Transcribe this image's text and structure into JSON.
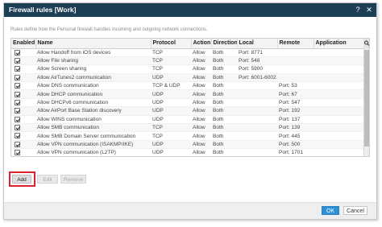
{
  "window": {
    "title": "Firewall rules [Work]"
  },
  "description": "Rules define how the Personal firewall handles incoming and outgoing network connections.",
  "table": {
    "columns": [
      "Enabled",
      "Name",
      "Protocol",
      "Action",
      "Direction",
      "Local",
      "Remote",
      "Application"
    ],
    "rows": [
      {
        "enabled": true,
        "name": "Allow Handoff from iOS devices",
        "protocol": "TCP",
        "action": "Allow",
        "direction": "Both",
        "local": "Port: 8771",
        "remote": "",
        "application": ""
      },
      {
        "enabled": true,
        "name": "Allow File sharing",
        "protocol": "TCP",
        "action": "Allow",
        "direction": "Both",
        "local": "Port: 548",
        "remote": "",
        "application": ""
      },
      {
        "enabled": true,
        "name": "Allow Screen sharing",
        "protocol": "TCP",
        "action": "Allow",
        "direction": "Both",
        "local": "Port: 5900",
        "remote": "",
        "application": ""
      },
      {
        "enabled": true,
        "name": "Allow AirTunes2 communication",
        "protocol": "UDP",
        "action": "Allow",
        "direction": "Both",
        "local": "Port: 6001-6002",
        "remote": "",
        "application": ""
      },
      {
        "enabled": true,
        "name": "Allow DNS communication",
        "protocol": "TCP & UDP",
        "action": "Allow",
        "direction": "Both",
        "local": "",
        "remote": "Port: 53",
        "application": ""
      },
      {
        "enabled": true,
        "name": "Allow DHCP communication",
        "protocol": "UDP",
        "action": "Allow",
        "direction": "Both",
        "local": "",
        "remote": "Port: 67",
        "application": ""
      },
      {
        "enabled": true,
        "name": "Allow DHCPv6 communication",
        "protocol": "UDP",
        "action": "Allow",
        "direction": "Both",
        "local": "",
        "remote": "Port: 547",
        "application": ""
      },
      {
        "enabled": true,
        "name": "Allow AirPort Base Station discovery",
        "protocol": "UDP",
        "action": "Allow",
        "direction": "Both",
        "local": "",
        "remote": "Port: 192",
        "application": ""
      },
      {
        "enabled": true,
        "name": "Allow WINS communication",
        "protocol": "UDP",
        "action": "Allow",
        "direction": "Both",
        "local": "",
        "remote": "Port: 137",
        "application": ""
      },
      {
        "enabled": true,
        "name": "Allow SMB communication",
        "protocol": "TCP",
        "action": "Allow",
        "direction": "Both",
        "local": "",
        "remote": "Port: 139",
        "application": ""
      },
      {
        "enabled": true,
        "name": "Allow SMB Domain Server communication",
        "protocol": "TCP",
        "action": "Allow",
        "direction": "Both",
        "local": "",
        "remote": "Port: 445",
        "application": ""
      },
      {
        "enabled": true,
        "name": "Allow VPN communication (ISAKMP/IKE)",
        "protocol": "UDP",
        "action": "Allow",
        "direction": "Both",
        "local": "",
        "remote": "Port: 500",
        "application": ""
      },
      {
        "enabled": true,
        "name": "Allow VPN communication (L2TP)",
        "protocol": "UDP",
        "action": "Allow",
        "direction": "Both",
        "local": "",
        "remote": "Port: 1701",
        "application": ""
      },
      {
        "enabled": true,
        "name": "Allow VPN communication (PPTP)",
        "protocol": "TCP",
        "action": "Allow",
        "direction": "Both",
        "local": "",
        "remote": "Port: 1723",
        "application": ""
      }
    ]
  },
  "buttons": {
    "add": "Add",
    "edit": "Edit",
    "remove": "Remove",
    "ok": "OK",
    "cancel": "Cancel"
  },
  "icons": {
    "help": "help-icon",
    "close": "close-icon",
    "search": "search-icon"
  },
  "colors": {
    "titlebar": "#1d3f56",
    "ok_button": "#2d8fd5",
    "highlight": "#d9232e"
  }
}
